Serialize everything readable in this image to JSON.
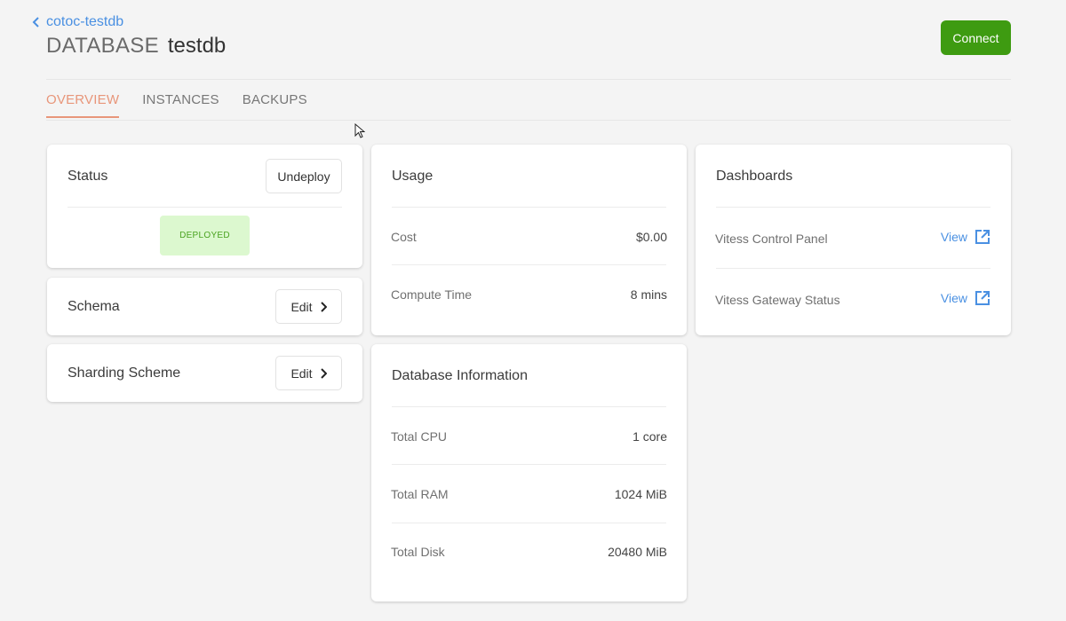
{
  "header": {
    "back_label": "cotoc-testdb",
    "title_prefix": "DATABASE",
    "title_name": "testdb",
    "connect_label": "Connect"
  },
  "tabs": [
    {
      "label": "OVERVIEW",
      "active": true
    },
    {
      "label": "INSTANCES",
      "active": false
    },
    {
      "label": "BACKUPS",
      "active": false
    }
  ],
  "status_card": {
    "title": "Status",
    "undeploy_label": "Undeploy",
    "badge": "DEPLOYED"
  },
  "schema_card": {
    "title": "Schema",
    "edit_label": "Edit"
  },
  "sharding_card": {
    "title": "Sharding Scheme",
    "edit_label": "Edit"
  },
  "usage_card": {
    "title": "Usage",
    "rows": [
      {
        "label": "Cost",
        "value": "$0.00"
      },
      {
        "label": "Compute Time",
        "value": "8 mins"
      }
    ]
  },
  "db_info_card": {
    "title": "Database Information",
    "rows": [
      {
        "label": "Total CPU",
        "value": "1 core"
      },
      {
        "label": "Total RAM",
        "value": "1024 MiB"
      },
      {
        "label": "Total Disk",
        "value": "20480 MiB"
      }
    ]
  },
  "dashboards_card": {
    "title": "Dashboards",
    "rows": [
      {
        "label": "Vitess Control Panel",
        "link": "View"
      },
      {
        "label": "Vitess Gateway Status",
        "link": "View"
      }
    ]
  },
  "colors": {
    "accent_tab": "#e8967a",
    "connect_green": "#3e9b11",
    "link_blue": "#4a90e2",
    "deployed_bg": "#dcf8cf",
    "deployed_text": "#4aa320"
  }
}
